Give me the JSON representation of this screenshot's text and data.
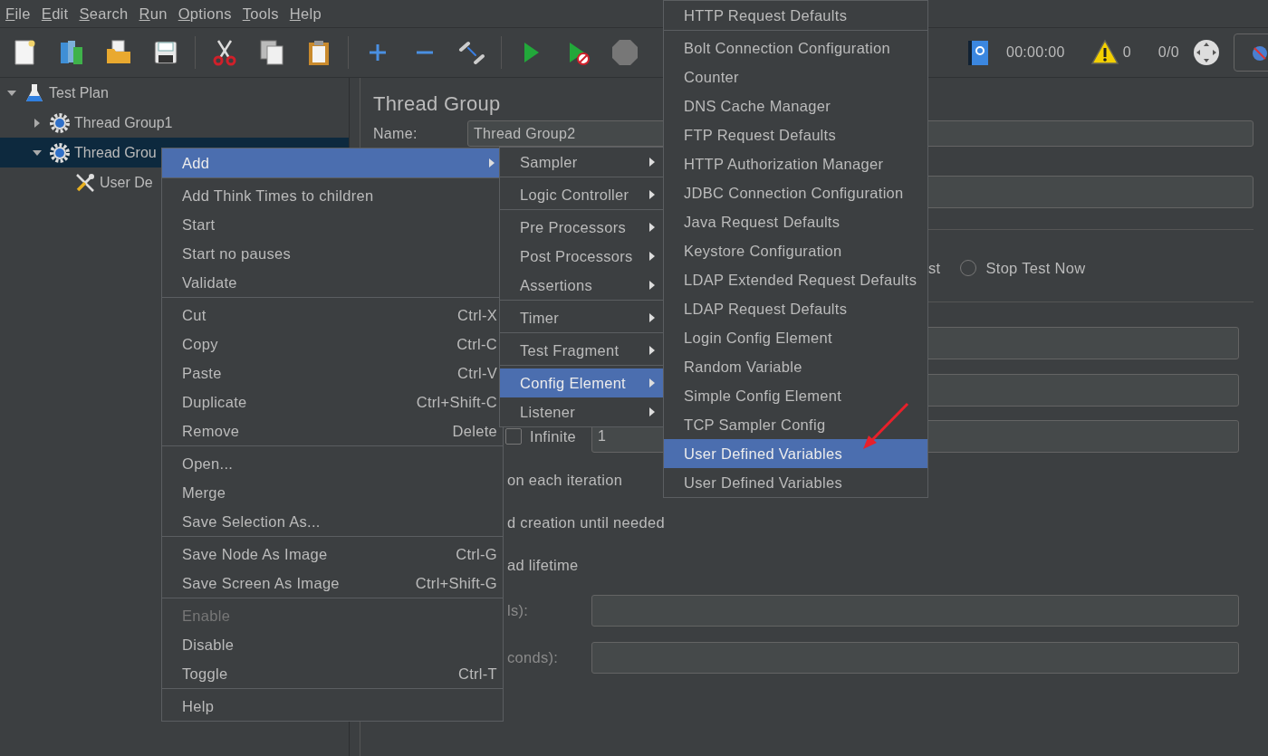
{
  "menubar": [
    "File",
    "Edit",
    "Search",
    "Run",
    "Options",
    "Tools",
    "Help"
  ],
  "toolbar": {
    "timer": "00:00:00",
    "warnings": "0",
    "threads": "0/0"
  },
  "tree": [
    {
      "label": "Test Plan",
      "kind": "plan",
      "expanded": true,
      "selected": false,
      "children": [
        {
          "label": "Thread Group1",
          "kind": "thread-group",
          "expanded": false,
          "selected": false
        },
        {
          "label": "Thread Grou",
          "kind": "thread-group",
          "expanded": true,
          "selected": true,
          "children": [
            {
              "label": "User De",
              "kind": "config",
              "selected": false
            }
          ]
        }
      ]
    }
  ],
  "panel": {
    "title": "Thread Group",
    "name_label": "Name:",
    "name_value": "Thread Group2",
    "action_fragment": "st",
    "stop_now": {
      "label": "Stop Test Now",
      "selected": false
    },
    "infinite": {
      "label": "Infinite",
      "checked": false
    },
    "loop_value": "1",
    "fragments": [
      "on each iteration",
      "d creation until needed",
      "ad lifetime"
    ],
    "duration_label": "ls):",
    "delay_label": "conds):"
  },
  "context_menu": {
    "groups": [
      [
        {
          "label": "Add",
          "selected": true,
          "disabled": false,
          "submenu": true
        }
      ],
      [
        {
          "label": "Add Think Times to children",
          "selected": false,
          "disabled": false,
          "submenu": false
        },
        {
          "label": "Start",
          "selected": false,
          "disabled": false,
          "submenu": false
        },
        {
          "label": "Start no pauses",
          "selected": false,
          "disabled": false,
          "submenu": false
        },
        {
          "label": "Validate",
          "selected": false,
          "disabled": false,
          "submenu": false
        }
      ],
      [
        {
          "label": "Cut",
          "shortcut": "Ctrl-X",
          "selected": false,
          "disabled": false,
          "submenu": false
        },
        {
          "label": "Copy",
          "shortcut": "Ctrl-C",
          "selected": false,
          "disabled": false,
          "submenu": false
        },
        {
          "label": "Paste",
          "shortcut": "Ctrl-V",
          "selected": false,
          "disabled": false,
          "submenu": false
        },
        {
          "label": "Duplicate",
          "shortcut": "Ctrl+Shift-C",
          "selected": false,
          "disabled": false,
          "submenu": false
        },
        {
          "label": "Remove",
          "shortcut": "Delete",
          "selected": false,
          "disabled": false,
          "submenu": false
        }
      ],
      [
        {
          "label": "Open...",
          "selected": false,
          "disabled": false,
          "submenu": false
        },
        {
          "label": "Merge",
          "selected": false,
          "disabled": false,
          "submenu": false
        },
        {
          "label": "Save Selection As...",
          "selected": false,
          "disabled": false,
          "submenu": false
        }
      ],
      [
        {
          "label": "Save Node As Image",
          "shortcut": "Ctrl-G",
          "selected": false,
          "disabled": false,
          "submenu": false
        },
        {
          "label": "Save Screen As Image",
          "shortcut": "Ctrl+Shift-G",
          "selected": false,
          "disabled": false,
          "submenu": false
        }
      ],
      [
        {
          "label": "Enable",
          "selected": false,
          "disabled": true,
          "submenu": false
        },
        {
          "label": "Disable",
          "selected": false,
          "disabled": false,
          "submenu": false
        },
        {
          "label": "Toggle",
          "shortcut": "Ctrl-T",
          "selected": false,
          "disabled": false,
          "submenu": false
        }
      ],
      [
        {
          "label": "Help",
          "selected": false,
          "disabled": false,
          "submenu": false
        }
      ]
    ]
  },
  "add_submenu": {
    "groups": [
      [
        {
          "label": "Sampler",
          "selected": false
        }
      ],
      [
        {
          "label": "Logic Controller",
          "selected": false
        }
      ],
      [
        {
          "label": "Pre Processors",
          "selected": false
        },
        {
          "label": "Post Processors",
          "selected": false
        },
        {
          "label": "Assertions",
          "selected": false
        }
      ],
      [
        {
          "label": "Timer",
          "selected": false
        }
      ],
      [
        {
          "label": "Test Fragment",
          "selected": false
        }
      ],
      [
        {
          "label": "Config Element",
          "selected": true
        },
        {
          "label": "Listener",
          "selected": false
        }
      ]
    ]
  },
  "config_submenu": {
    "groups": [
      [
        {
          "label": "HTTP Request Defaults",
          "selected": false
        }
      ],
      [
        {
          "label": "Bolt Connection Configuration",
          "selected": false
        },
        {
          "label": "Counter",
          "selected": false
        },
        {
          "label": "DNS Cache Manager",
          "selected": false
        },
        {
          "label": "FTP Request Defaults",
          "selected": false
        },
        {
          "label": "HTTP Authorization Manager",
          "selected": false
        },
        {
          "label": "JDBC Connection Configuration",
          "selected": false
        },
        {
          "label": "Java Request Defaults",
          "selected": false
        },
        {
          "label": "Keystore Configuration",
          "selected": false
        },
        {
          "label": "LDAP Extended Request Defaults",
          "selected": false
        },
        {
          "label": "LDAP Request Defaults",
          "selected": false
        },
        {
          "label": "Login Config Element",
          "selected": false
        },
        {
          "label": "Random Variable",
          "selected": false
        },
        {
          "label": "Simple Config Element",
          "selected": false
        },
        {
          "label": "TCP Sampler Config",
          "selected": false
        },
        {
          "label": "User Defined Variables",
          "selected": true
        },
        {
          "label": "User Defined Variables",
          "selected": false
        }
      ]
    ]
  }
}
